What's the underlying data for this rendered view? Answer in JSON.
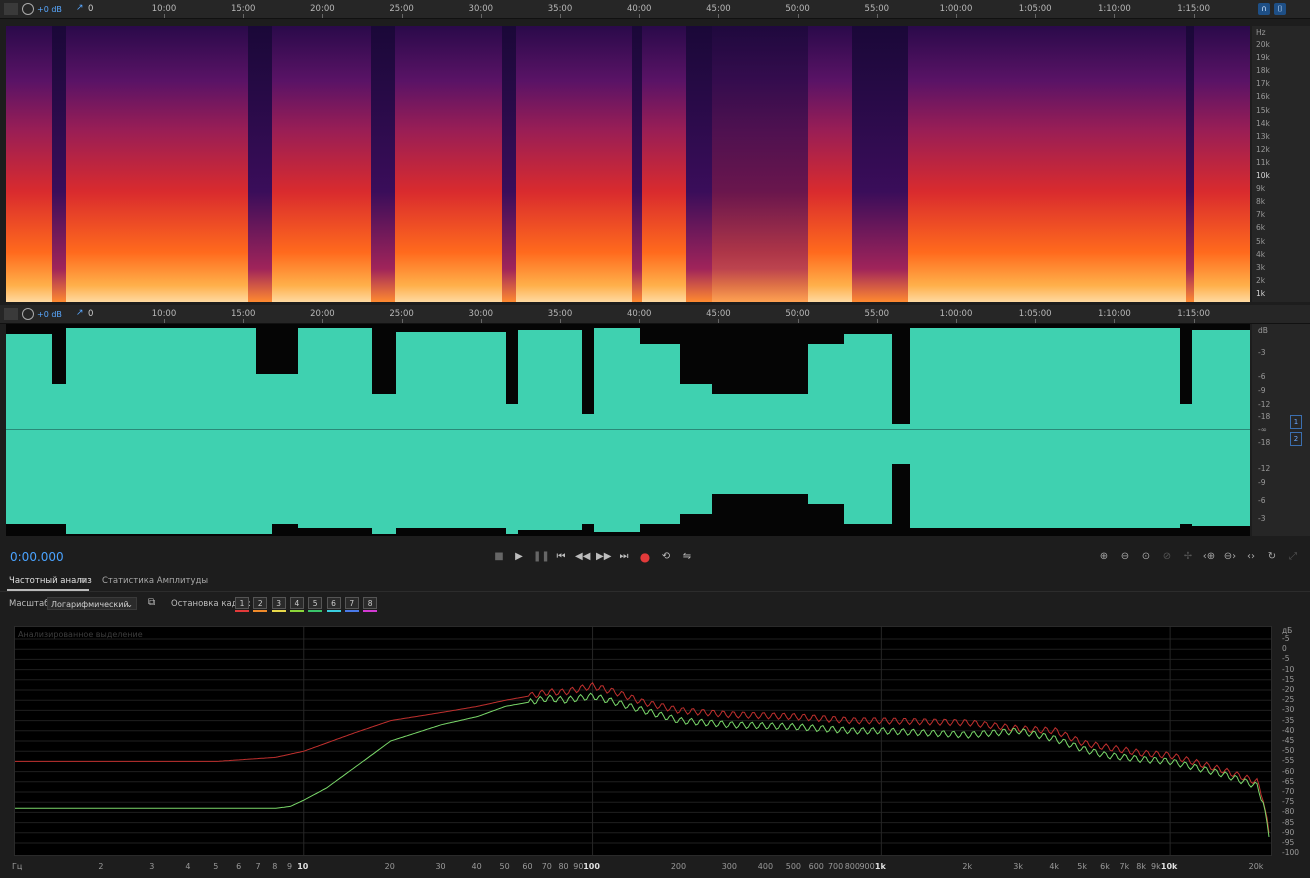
{
  "ruler": {
    "volume_label": "+0 dB",
    "start_label": "0",
    "ticks": [
      "10:00",
      "15:00",
      "20:00",
      "25:00",
      "30:00",
      "35:00",
      "40:00",
      "45:00",
      "50:00",
      "55:00",
      "1:00:00",
      "1:05:00",
      "1:10:00",
      "1:15:00"
    ]
  },
  "spectral_axis": {
    "unit": "Hz",
    "labels": [
      "20k",
      "19k",
      "18k",
      "17k",
      "16k",
      "15k",
      "14k",
      "13k",
      "12k",
      "11k",
      "10k",
      "9k",
      "8k",
      "7k",
      "6k",
      "5k",
      "4k",
      "3k",
      "2k",
      "1k"
    ]
  },
  "amplitude_axis": {
    "unit": "dB",
    "labels": [
      "-3",
      "-6",
      "-9",
      "-12",
      "-18",
      "-∞",
      "-18",
      "-12",
      "-9",
      "-6",
      "-3"
    ],
    "channels": [
      "1",
      "2"
    ]
  },
  "transport": {
    "time": "0:00.000",
    "buttons": [
      "stop",
      "play",
      "pause",
      "go-to-start",
      "rewind",
      "fast-forward",
      "go-to-end",
      "record",
      "loop",
      "skip-selection"
    ]
  },
  "panel": {
    "tabs": [
      {
        "label": "Частотный анализ",
        "active": true
      },
      {
        "label": "Статистика Амплитуды",
        "active": false
      }
    ],
    "scale_label": "Масштаб:",
    "scale_value": "Логарифмический",
    "freeze_label": "Остановка кадра:",
    "frames": [
      {
        "label": "1",
        "color": "#e23a3a"
      },
      {
        "label": "2",
        "color": "#f08a2a"
      },
      {
        "label": "3",
        "color": "#e8d84a"
      },
      {
        "label": "4",
        "color": "#8cd63a"
      },
      {
        "label": "5",
        "color": "#3ac46a"
      },
      {
        "label": "6",
        "color": "#3acfe0"
      },
      {
        "label": "7",
        "color": "#4a7ae8"
      },
      {
        "label": "8",
        "color": "#d23ad2"
      }
    ],
    "graph_caption": "Анализированное выделение"
  },
  "chart_data": {
    "type": "line",
    "xscale": "log",
    "xlabel": "Гц",
    "ylabel": "дБ",
    "xlim": [
      1,
      22000
    ],
    "ylim": [
      -100,
      0
    ],
    "x_ticks": [
      "2",
      "3",
      "4",
      "5",
      "6",
      "7",
      "8",
      "9",
      "10",
      "20",
      "30",
      "40",
      "50",
      "60",
      "70",
      "80",
      "90",
      "100",
      "200",
      "300",
      "400",
      "500",
      "600",
      "700",
      "800",
      "900",
      "1k",
      "2k",
      "3k",
      "4k",
      "5k",
      "6k",
      "7k",
      "8k",
      "9k",
      "10k",
      "20k"
    ],
    "y_ticks": [
      "-5",
      "0",
      "-5",
      "-10",
      "-15",
      "-20",
      "-25",
      "-30",
      "-35",
      "-40",
      "-45",
      "-50",
      "-55",
      "-60",
      "-65",
      "-70",
      "-75",
      "-80",
      "-85",
      "-90",
      "-95",
      "-100"
    ],
    "series": [
      {
        "color": "#c0302e",
        "x": [
          1,
          5,
          8,
          10,
          15,
          20,
          30,
          40,
          50,
          60,
          70,
          80,
          100,
          120,
          150,
          200,
          300,
          500,
          800,
          1000,
          2000,
          3000,
          4000,
          5000,
          6000,
          8000,
          10000,
          15000,
          20000,
          21000,
          22000
        ],
        "y": [
          -60,
          -60,
          -58,
          -55,
          -46,
          -40,
          -36,
          -33,
          -30,
          -28,
          -26,
          -26,
          -23,
          -26,
          -31,
          -35,
          -37,
          -38,
          -40,
          -40,
          -41,
          -44,
          -45,
          -51,
          -53,
          -56,
          -57,
          -64,
          -70,
          -78,
          -95
        ]
      },
      {
        "color": "#7ad86a",
        "x": [
          1,
          5,
          8,
          9,
          10,
          12,
          15,
          20,
          30,
          40,
          50,
          60,
          70,
          80,
          100,
          120,
          150,
          200,
          300,
          500,
          800,
          1000,
          2000,
          3000,
          4000,
          5000,
          6000,
          8000,
          10000,
          15000,
          20000,
          21000,
          22000
        ],
        "y": [
          -83,
          -83,
          -83,
          -82,
          -79,
          -73,
          -63,
          -50,
          -42,
          -38,
          -33,
          -31,
          -29,
          -30,
          -28,
          -31,
          -35,
          -40,
          -42,
          -43,
          -45,
          -45,
          -47,
          -45,
          -49,
          -54,
          -57,
          -59,
          -60,
          -66,
          -72,
          -80,
          -97
        ]
      }
    ]
  }
}
